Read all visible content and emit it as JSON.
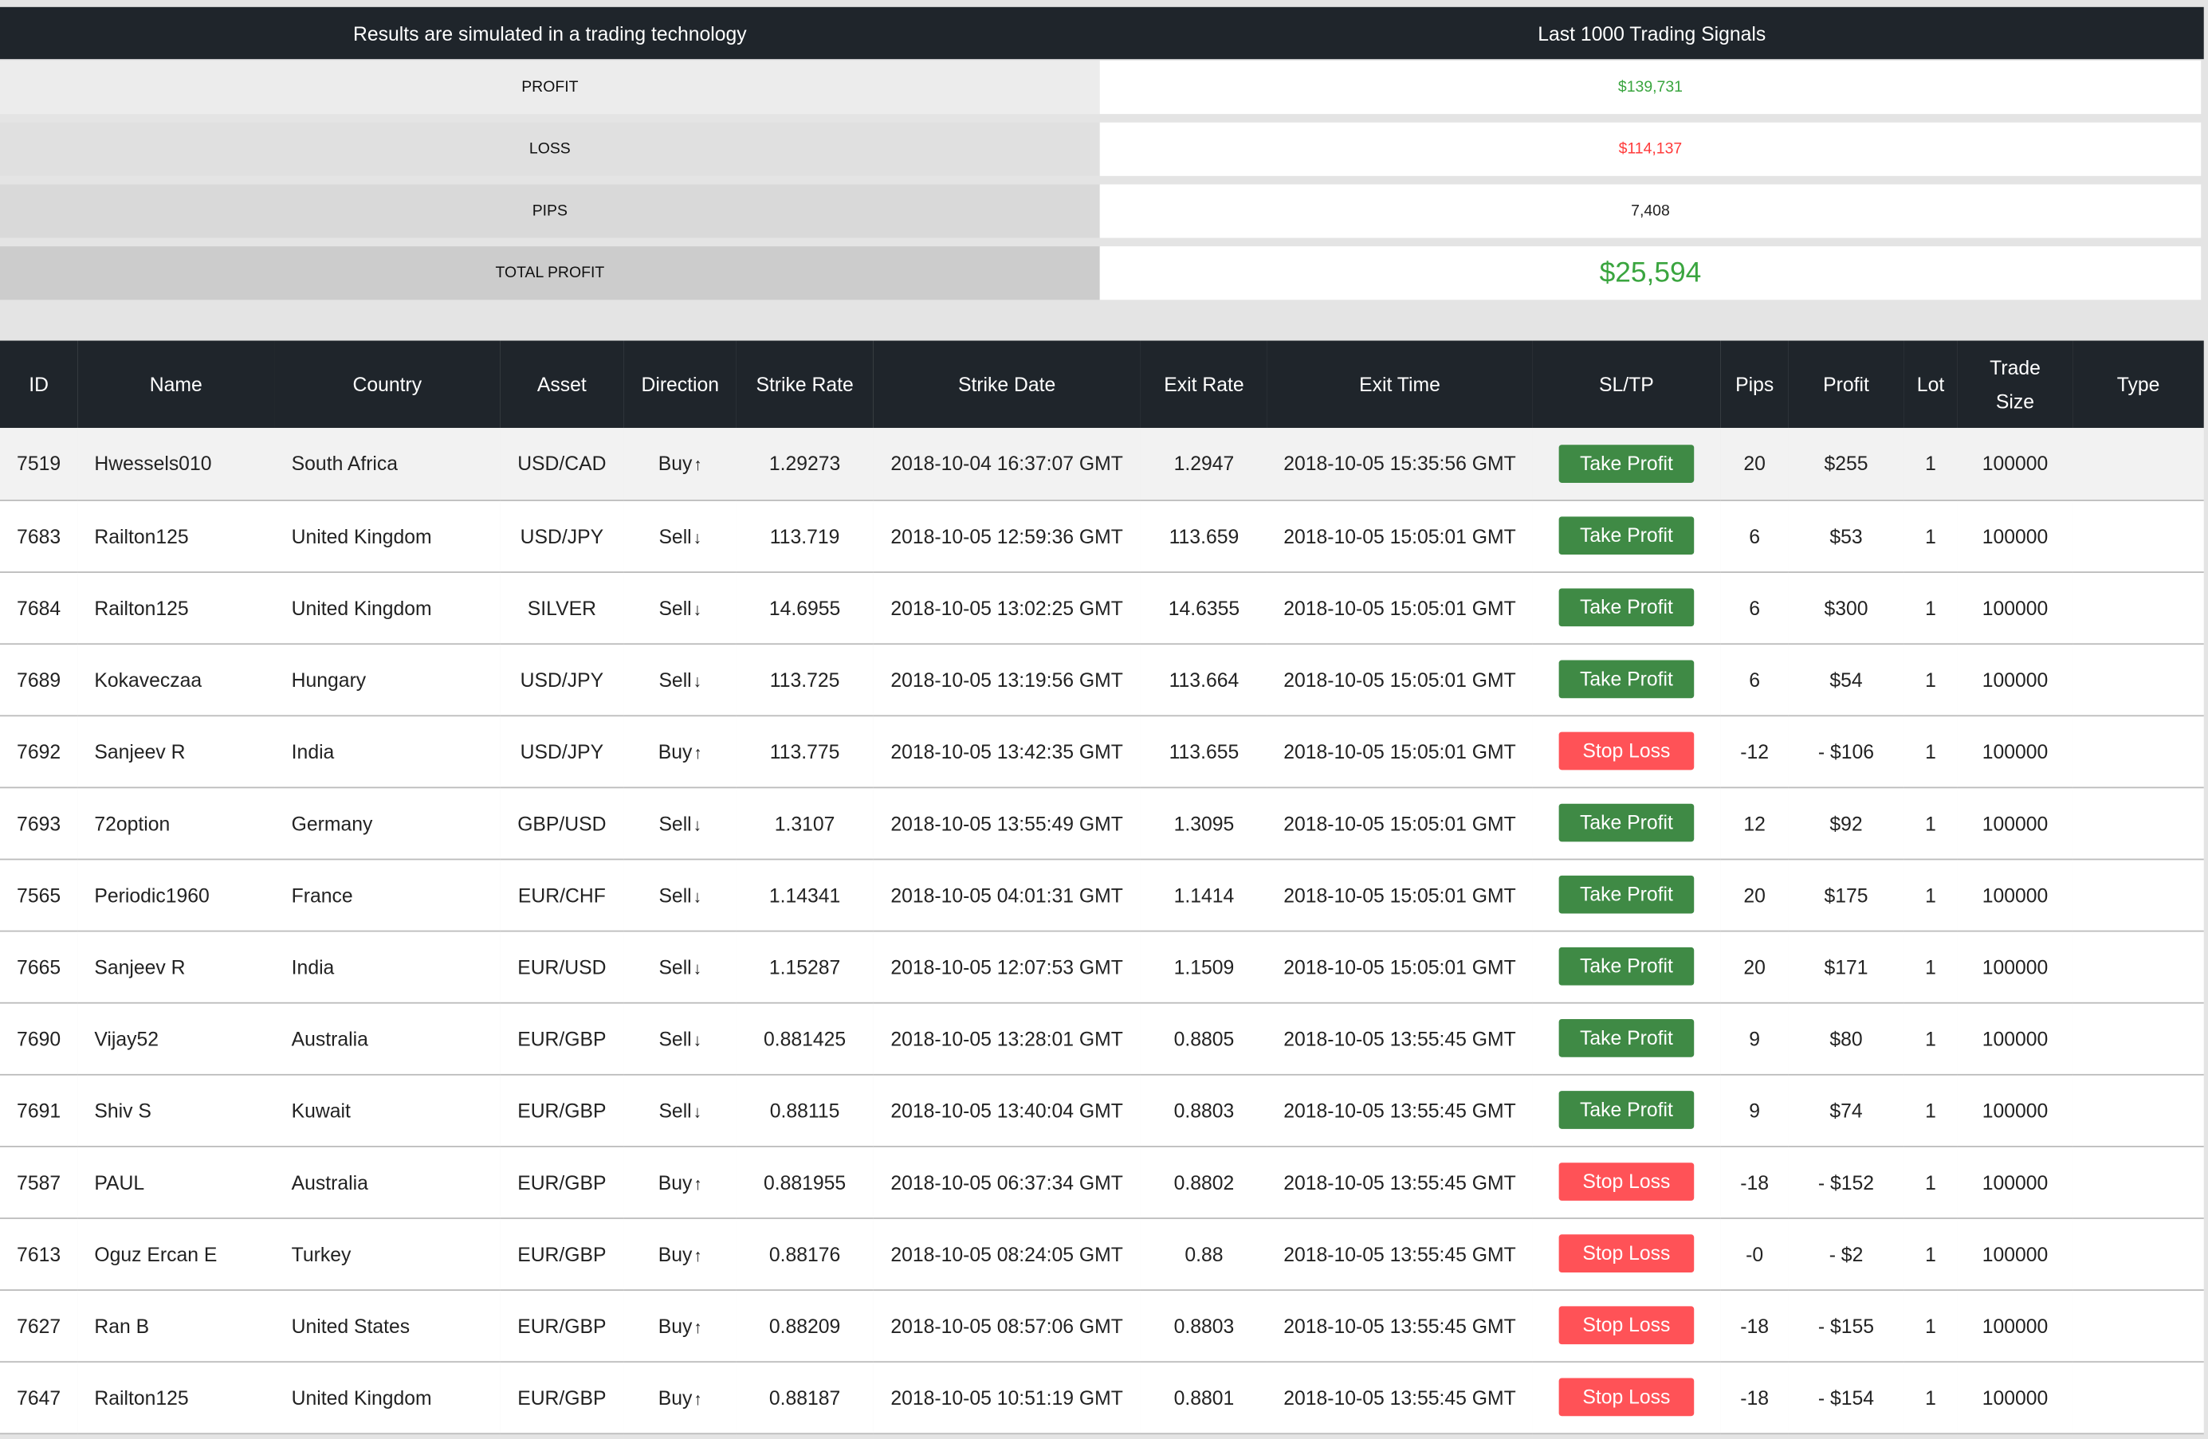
{
  "banner": {
    "left": "Results are simulated in a trading technology",
    "right": "Last 1000 Trading Signals"
  },
  "summary": [
    {
      "label": "PROFIT",
      "value": "$139,731",
      "color": "#3aa53f"
    },
    {
      "label": "LOSS",
      "value": "$114,137",
      "color": "#ff3b3b"
    },
    {
      "label": "PIPS",
      "value": "7,408",
      "color": "#222222"
    },
    {
      "label": "TOTAL PROFIT",
      "value": "$25,594",
      "color": "#3aa53f"
    }
  ],
  "colors": {
    "header_bg": "#1f252b",
    "take_profit": "#3f8a45",
    "stop_loss": "#ff5257"
  },
  "table": {
    "columns": [
      "ID",
      "Name",
      "Country",
      "Asset",
      "Direction",
      "Strike Rate",
      "Strike Date",
      "Exit Rate",
      "Exit Time",
      "SL/TP",
      "Pips",
      "Profit",
      "Lot",
      "Trade Size",
      "Type"
    ],
    "rows": [
      [
        "7519",
        "Hwessels010",
        "South Africa",
        "USD/CAD",
        "Buy",
        "1.29273",
        "2018-10-04 16:37:07 GMT",
        "1.2947",
        "2018-10-05 15:35:56 GMT",
        "Take Profit",
        "20",
        "$255",
        "1",
        "100000",
        ""
      ],
      [
        "7683",
        "Railton125",
        "United Kingdom",
        "USD/JPY",
        "Sell",
        "113.719",
        "2018-10-05 12:59:36 GMT",
        "113.659",
        "2018-10-05 15:05:01 GMT",
        "Take Profit",
        "6",
        "$53",
        "1",
        "100000",
        ""
      ],
      [
        "7684",
        "Railton125",
        "United Kingdom",
        "SILVER",
        "Sell",
        "14.6955",
        "2018-10-05 13:02:25 GMT",
        "14.6355",
        "2018-10-05 15:05:01 GMT",
        "Take Profit",
        "6",
        "$300",
        "1",
        "100000",
        ""
      ],
      [
        "7689",
        "Kokaveczaa",
        "Hungary",
        "USD/JPY",
        "Sell",
        "113.725",
        "2018-10-05 13:19:56 GMT",
        "113.664",
        "2018-10-05 15:05:01 GMT",
        "Take Profit",
        "6",
        "$54",
        "1",
        "100000",
        ""
      ],
      [
        "7692",
        "Sanjeev R",
        "India",
        "USD/JPY",
        "Buy",
        "113.775",
        "2018-10-05 13:42:35 GMT",
        "113.655",
        "2018-10-05 15:05:01 GMT",
        "Stop Loss",
        "-12",
        "- $106",
        "1",
        "100000",
        ""
      ],
      [
        "7693",
        "72option",
        "Germany",
        "GBP/USD",
        "Sell",
        "1.3107",
        "2018-10-05 13:55:49 GMT",
        "1.3095",
        "2018-10-05 15:05:01 GMT",
        "Take Profit",
        "12",
        "$92",
        "1",
        "100000",
        ""
      ],
      [
        "7565",
        "Periodic1960",
        "France",
        "EUR/CHF",
        "Sell",
        "1.14341",
        "2018-10-05 04:01:31 GMT",
        "1.1414",
        "2018-10-05 15:05:01 GMT",
        "Take Profit",
        "20",
        "$175",
        "1",
        "100000",
        ""
      ],
      [
        "7665",
        "Sanjeev R",
        "India",
        "EUR/USD",
        "Sell",
        "1.15287",
        "2018-10-05 12:07:53 GMT",
        "1.1509",
        "2018-10-05 15:05:01 GMT",
        "Take Profit",
        "20",
        "$171",
        "1",
        "100000",
        ""
      ],
      [
        "7690",
        "Vijay52",
        "Australia",
        "EUR/GBP",
        "Sell",
        "0.881425",
        "2018-10-05 13:28:01 GMT",
        "0.8805",
        "2018-10-05 13:55:45 GMT",
        "Take Profit",
        "9",
        "$80",
        "1",
        "100000",
        ""
      ],
      [
        "7691",
        "Shiv S",
        "Kuwait",
        "EUR/GBP",
        "Sell",
        "0.88115",
        "2018-10-05 13:40:04 GMT",
        "0.8803",
        "2018-10-05 13:55:45 GMT",
        "Take Profit",
        "9",
        "$74",
        "1",
        "100000",
        ""
      ],
      [
        "7587",
        "PAUL",
        "Australia",
        "EUR/GBP",
        "Buy",
        "0.881955",
        "2018-10-05 06:37:34 GMT",
        "0.8802",
        "2018-10-05 13:55:45 GMT",
        "Stop Loss",
        "-18",
        "- $152",
        "1",
        "100000",
        ""
      ],
      [
        "7613",
        "Oguz Ercan E",
        "Turkey",
        "EUR/GBP",
        "Buy",
        "0.88176",
        "2018-10-05 08:24:05 GMT",
        "0.88",
        "2018-10-05 13:55:45 GMT",
        "Stop Loss",
        "-0",
        "- $2",
        "1",
        "100000",
        ""
      ],
      [
        "7627",
        "Ran B",
        "United States",
        "EUR/GBP",
        "Buy",
        "0.88209",
        "2018-10-05 08:57:06 GMT",
        "0.8803",
        "2018-10-05 13:55:45 GMT",
        "Stop Loss",
        "-18",
        "- $155",
        "1",
        "100000",
        ""
      ],
      [
        "7647",
        "Railton125",
        "United Kingdom",
        "EUR/GBP",
        "Buy",
        "0.88187",
        "2018-10-05 10:51:19 GMT",
        "0.8801",
        "2018-10-05 13:55:45 GMT",
        "Stop Loss",
        "-18",
        "- $154",
        "1",
        "100000",
        ""
      ]
    ]
  }
}
